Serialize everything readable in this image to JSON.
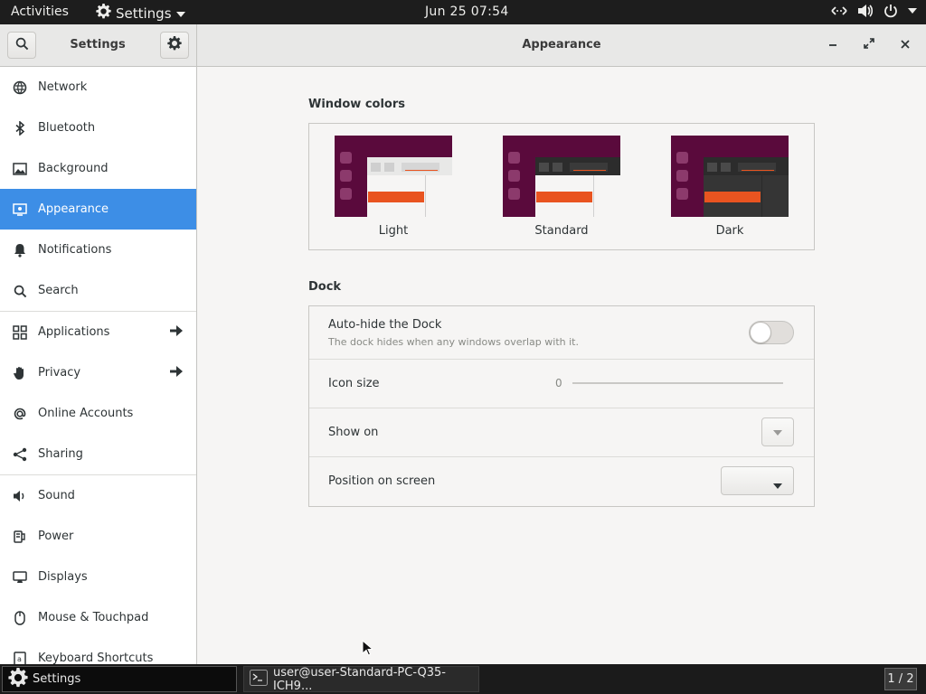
{
  "topbar": {
    "activities": "Activities",
    "app_menu": "Settings",
    "clock": "Jun 25  07:54"
  },
  "headerbar": {
    "sidebar_title": "Settings",
    "page_title": "Appearance"
  },
  "sidebar": {
    "items": [
      {
        "label": "Network",
        "icon": "network-icon"
      },
      {
        "label": "Bluetooth",
        "icon": "bluetooth-icon"
      },
      {
        "label": "Background",
        "icon": "background-icon"
      },
      {
        "label": "Appearance",
        "icon": "appearance-icon",
        "active": true
      },
      {
        "label": "Notifications",
        "icon": "bell-icon"
      },
      {
        "label": "Search",
        "icon": "search-icon"
      },
      {
        "label": "Applications",
        "icon": "apps-grid-icon",
        "has_arrow": true
      },
      {
        "label": "Privacy",
        "icon": "hand-icon",
        "has_arrow": true
      },
      {
        "label": "Online Accounts",
        "icon": "at-sign-icon"
      },
      {
        "label": "Sharing",
        "icon": "share-icon"
      },
      {
        "label": "Sound",
        "icon": "speaker-icon"
      },
      {
        "label": "Power",
        "icon": "power-plug-icon"
      },
      {
        "label": "Displays",
        "icon": "display-icon"
      },
      {
        "label": "Mouse & Touchpad",
        "icon": "mouse-icon"
      },
      {
        "label": "Keyboard Shortcuts",
        "icon": "keyboard-icon"
      }
    ]
  },
  "window_colors": {
    "title": "Window colors",
    "themes": [
      {
        "label": "Light"
      },
      {
        "label": "Standard"
      },
      {
        "label": "Dark"
      }
    ]
  },
  "dock": {
    "title": "Dock",
    "autohide": {
      "label": "Auto-hide the Dock",
      "description": "The dock hides when any windows overlap with it.",
      "enabled": false
    },
    "icon_size": {
      "label": "Icon size",
      "value": "0"
    },
    "show_on": {
      "label": "Show on"
    },
    "position": {
      "label": "Position on screen",
      "value": ""
    }
  },
  "taskbar": {
    "tasks": [
      {
        "label": "Settings",
        "active": true
      },
      {
        "label": "user@user-Standard-PC-Q35-ICH9...",
        "active": false
      }
    ],
    "workspace": "1 / 2"
  },
  "colors": {
    "accent": "#3d8ee6",
    "ubuntu_orange": "#e95420",
    "aubergine": "#5a0a3c"
  }
}
